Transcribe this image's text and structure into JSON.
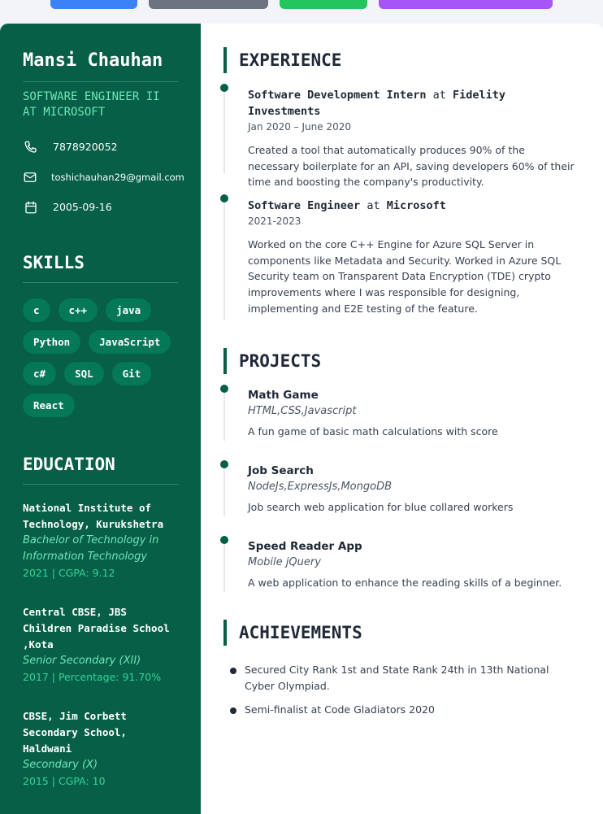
{
  "profile": {
    "name": "Mansi Chauhan",
    "role_line1": "SOFTWARE ENGINEER II",
    "role_line2": "AT MICROSOFT",
    "phone": "7878920052",
    "email": "toshichauhan29@gmail.com",
    "dob": "2005-09-16"
  },
  "skills": {
    "heading": "SKILLS",
    "items": [
      "c",
      "c++",
      "java",
      "Python",
      "JavaScript",
      "c#",
      "SQL",
      "Git",
      "React"
    ]
  },
  "education": {
    "heading": "EDUCATION",
    "items": [
      {
        "school": "National Institute of Technology, Kurukshetra",
        "degree": "Bachelor of Technology in Information Technology",
        "score": "2021 | CGPA: 9.12"
      },
      {
        "school": "Central CBSE, JBS Children Paradise School ,Kota",
        "degree": "Senior Secondary (XII)",
        "score": "2017 | Percentage: 91.70%"
      },
      {
        "school": "CBSE, Jim Corbett Secondary School, Haldwani",
        "degree": "Secondary (X)",
        "score": "2015 | CGPA: 10"
      }
    ]
  },
  "experience": {
    "heading": "EXPERIENCE",
    "connector": "at",
    "items": [
      {
        "title": "Software Development Intern",
        "company": "Fidelity Investments",
        "date": "Jan 2020 – June 2020",
        "desc": "Created a tool that automatically produces 90% of the necessary boilerplate for an API, saving developers 60% of their time and boosting the company's productivity."
      },
      {
        "title": "Software Engineer",
        "company": "Microsoft",
        "date": "2021-2023",
        "desc": "Worked on the core C++ Engine for Azure SQL Server in components like Metadata and Security. Worked in Azure SQL Security team on Transparent Data Encryption (TDE) crypto improvements where I was responsible for designing, implementing and E2E testing of the feature."
      }
    ]
  },
  "projects": {
    "heading": "PROJECTS",
    "items": [
      {
        "name": "Math Game",
        "tech": "HTML,CSS,Javascript",
        "desc": "A fun game of basic math calculations with score"
      },
      {
        "name": "Job Search",
        "tech": "NodeJs,ExpressJs,MongoDB",
        "desc": "Job search web application for blue collared workers"
      },
      {
        "name": "Speed Reader App",
        "tech": "Mobile jQuery",
        "desc": "A web application to enhance the reading skills of a beginner."
      }
    ]
  },
  "achievements": {
    "heading": "ACHIEVEMENTS",
    "items": [
      "Secured City Rank 1st and State Rank 24th in 13th National Cyber Olympiad.",
      "Semi-finalist at Code Gladiators 2020"
    ]
  },
  "colors": {
    "sidebar": "#065f46",
    "accent": "#6ee7b7",
    "button_blue": "#3b82f6",
    "button_gray": "#6b7280",
    "button_green": "#22c55e",
    "button_purple": "#a855f7"
  }
}
